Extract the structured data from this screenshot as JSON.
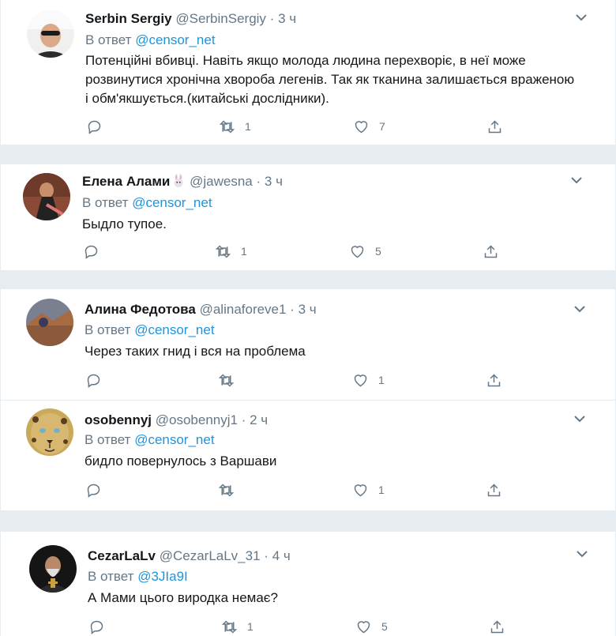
{
  "reply_prefix": "В ответ",
  "tweets": [
    {
      "name": "Serbin Sergiy",
      "handle": "@SerbinSergiy",
      "sep": "·",
      "time": "3 ч",
      "mention": "@censor_net",
      "text": "Потенційні вбивці. Навіть якщо молода людина перехворіє, в неї може розвинутися хронічна хвороба легенів. Так як тканина залишається враженою і обм'якшується.(китайські дослідники).",
      "retweets": "1",
      "likes": "7"
    },
    {
      "name": "Елена Алами",
      "handle": "@jawesna",
      "sep": "·",
      "time": "3 ч",
      "mention": "@censor_net",
      "text": "Быдло тупое.",
      "retweets": "1",
      "likes": "5"
    },
    {
      "name": "Алина Федотова",
      "handle": "@alinaforeve1",
      "sep": "·",
      "time": "3 ч",
      "mention": "@censor_net",
      "text": "Через таких гнид і вся на проблема",
      "retweets": "",
      "likes": "1"
    },
    {
      "name": "osobennyj",
      "handle": "@osobennyj1",
      "sep": "·",
      "time": "2 ч",
      "mention": "@censor_net",
      "text": "бидло повернулось з Варшави",
      "retweets": "",
      "likes": "1"
    },
    {
      "name": "CezarLaLv",
      "handle": "@CezarLaLv_31",
      "sep": "·",
      "time": "4 ч",
      "mention": "@3JIa9I",
      "text": "А Мами цього виродка немає?",
      "retweets": "1",
      "likes": "5"
    }
  ],
  "icons": {
    "reply": "reply-icon",
    "retweet": "retweet-icon",
    "like": "heart-icon",
    "share": "share-icon",
    "more": "chevron-down-icon",
    "emoji": "rabbit-emoji-icon"
  },
  "colors": {
    "link": "#1b95e0",
    "secondary": "#657786",
    "text": "#14171a",
    "divider": "#e6ecf0"
  }
}
